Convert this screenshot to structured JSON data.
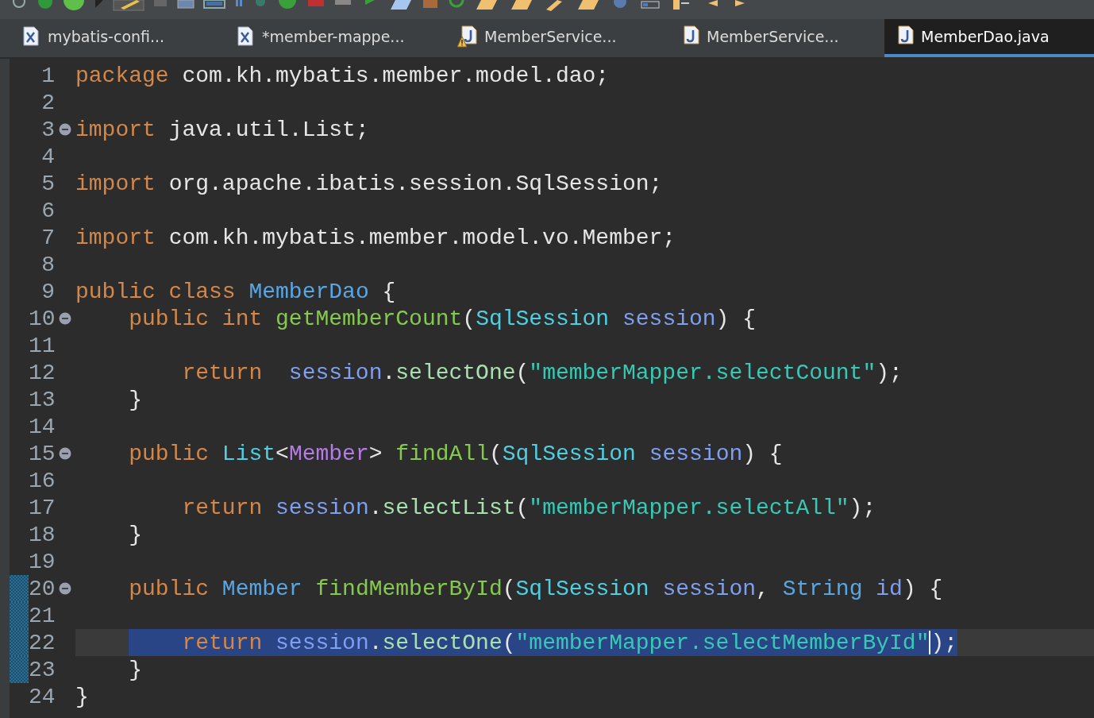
{
  "tabs": [
    {
      "label": "mybatis-confi...",
      "kind": "xml",
      "warning": false,
      "selected": false
    },
    {
      "label": "*member-mappe...",
      "kind": "xml",
      "warning": false,
      "selected": false
    },
    {
      "label": "MemberService...",
      "kind": "java",
      "warning": true,
      "selected": false
    },
    {
      "label": "MemberService...",
      "kind": "java",
      "warning": false,
      "selected": false
    },
    {
      "label": "MemberDao.java",
      "kind": "java",
      "warning": false,
      "selected": true
    }
  ],
  "editor": {
    "lines": [
      {
        "number": "1",
        "fold": false,
        "changed": false,
        "selected": false,
        "tokens": [
          {
            "text": "package",
            "kind": "keyword"
          },
          {
            "text": " com.kh.mybatis.member.model.dao;",
            "kind": "plain"
          }
        ]
      },
      {
        "number": "2",
        "fold": false,
        "changed": false,
        "selected": false
      },
      {
        "number": "3",
        "fold": true,
        "changed": false,
        "selected": false,
        "tokens": [
          {
            "text": "import",
            "kind": "keyword"
          },
          {
            "text": " java.util.List;",
            "kind": "plain"
          }
        ]
      },
      {
        "number": "4",
        "fold": false,
        "changed": false,
        "selected": false
      },
      {
        "number": "5",
        "fold": false,
        "changed": false,
        "selected": false,
        "tokens": [
          {
            "text": "import",
            "kind": "keyword"
          },
          {
            "text": " org.apache.ibatis.session.SqlSession;",
            "kind": "plain"
          }
        ]
      },
      {
        "number": "6",
        "fold": false,
        "changed": false,
        "selected": false
      },
      {
        "number": "7",
        "fold": false,
        "changed": false,
        "selected": false,
        "tokens": [
          {
            "text": "import",
            "kind": "keyword"
          },
          {
            "text": " com.kh.mybatis.member.model.vo.Member;",
            "kind": "plain"
          }
        ]
      },
      {
        "number": "8",
        "fold": false,
        "changed": false,
        "selected": false
      },
      {
        "number": "9",
        "fold": false,
        "changed": false,
        "selected": false,
        "tokens": [
          {
            "text": "public class",
            "kind": "keyword"
          },
          {
            "text": " MemberDao",
            "kind": "type"
          },
          {
            "text": " {",
            "kind": "plain"
          }
        ]
      },
      {
        "number": "10",
        "fold": true,
        "changed": false,
        "selected": false,
        "tokens": [
          {
            "text": "    public int",
            "kind": "keyword"
          },
          {
            "text": " getMemberCount",
            "kind": "method-decl"
          },
          {
            "text": "(",
            "kind": "plain"
          },
          {
            "text": "SqlSession",
            "kind": "type-ref"
          },
          {
            "text": " session",
            "kind": "param"
          },
          {
            "text": ") {",
            "kind": "plain"
          }
        ]
      },
      {
        "number": "11",
        "fold": false,
        "changed": false,
        "selected": false
      },
      {
        "number": "12",
        "fold": false,
        "changed": false,
        "selected": false,
        "tokens": [
          {
            "text": "        return",
            "kind": "keyword"
          },
          {
            "text": "  session",
            "kind": "param"
          },
          {
            "text": ".",
            "kind": "plain"
          },
          {
            "text": "selectOne",
            "kind": "method-call"
          },
          {
            "text": "(",
            "kind": "plain"
          },
          {
            "text": "\"memberMapper.selectCount\"",
            "kind": "string"
          },
          {
            "text": ");",
            "kind": "plain"
          }
        ]
      },
      {
        "number": "13",
        "fold": false,
        "changed": false,
        "selected": false,
        "tokens": [
          {
            "text": "    }",
            "kind": "plain"
          }
        ]
      },
      {
        "number": "14",
        "fold": false,
        "changed": false,
        "selected": false
      },
      {
        "number": "15",
        "fold": true,
        "changed": false,
        "selected": false,
        "tokens": [
          {
            "text": "    public",
            "kind": "keyword"
          },
          {
            "text": " List",
            "kind": "type-ref"
          },
          {
            "text": "<",
            "kind": "plain"
          },
          {
            "text": "Member",
            "kind": "type-arg"
          },
          {
            "text": ">",
            "kind": "plain"
          },
          {
            "text": " findAll",
            "kind": "method-decl"
          },
          {
            "text": "(",
            "kind": "plain"
          },
          {
            "text": "SqlSession",
            "kind": "type-ref"
          },
          {
            "text": " session",
            "kind": "param"
          },
          {
            "text": ") {",
            "kind": "plain"
          }
        ]
      },
      {
        "number": "16",
        "fold": false,
        "changed": false,
        "selected": false
      },
      {
        "number": "17",
        "fold": false,
        "changed": false,
        "selected": false,
        "tokens": [
          {
            "text": "        return",
            "kind": "keyword"
          },
          {
            "text": " session",
            "kind": "param"
          },
          {
            "text": ".",
            "kind": "plain"
          },
          {
            "text": "selectList",
            "kind": "method-call"
          },
          {
            "text": "(",
            "kind": "plain"
          },
          {
            "text": "\"memberMapper.selectAll\"",
            "kind": "string"
          },
          {
            "text": ");",
            "kind": "plain"
          }
        ]
      },
      {
        "number": "18",
        "fold": false,
        "changed": false,
        "selected": false,
        "tokens": [
          {
            "text": "    }",
            "kind": "plain"
          }
        ]
      },
      {
        "number": "19",
        "fold": false,
        "changed": false,
        "selected": false
      },
      {
        "number": "20",
        "fold": true,
        "changed": true,
        "selected": false,
        "tokens": [
          {
            "text": "    public",
            "kind": "keyword"
          },
          {
            "text": " Member",
            "kind": "type"
          },
          {
            "text": " findMemberById",
            "kind": "method-decl"
          },
          {
            "text": "(",
            "kind": "plain"
          },
          {
            "text": "SqlSession",
            "kind": "type-ref"
          },
          {
            "text": " session",
            "kind": "param"
          },
          {
            "text": ",",
            "kind": "plain"
          },
          {
            "text": " String",
            "kind": "type"
          },
          {
            "text": " id",
            "kind": "param"
          },
          {
            "text": ") {",
            "kind": "plain"
          }
        ]
      },
      {
        "number": "21",
        "fold": false,
        "changed": true,
        "selected": false
      },
      {
        "number": "22",
        "fold": false,
        "changed": true,
        "selected": true,
        "tokens": [
          {
            "text": "        return",
            "kind": "keyword"
          },
          {
            "text": " session",
            "kind": "param"
          },
          {
            "text": ".",
            "kind": "plain"
          },
          {
            "text": "selectOne",
            "kind": "method-call"
          },
          {
            "text": "(",
            "kind": "plain"
          },
          {
            "text": "\"memberMapper.selectMemberById\"",
            "kind": "string"
          },
          {
            "text": ");",
            "kind": "plain",
            "caret_before": true
          }
        ]
      },
      {
        "number": "23",
        "fold": false,
        "changed": true,
        "selected": false,
        "tokens": [
          {
            "text": "    }",
            "kind": "plain"
          }
        ]
      },
      {
        "number": "24",
        "fold": false,
        "changed": false,
        "selected": false,
        "tokens": [
          {
            "text": "}",
            "kind": "plain"
          }
        ]
      }
    ]
  }
}
